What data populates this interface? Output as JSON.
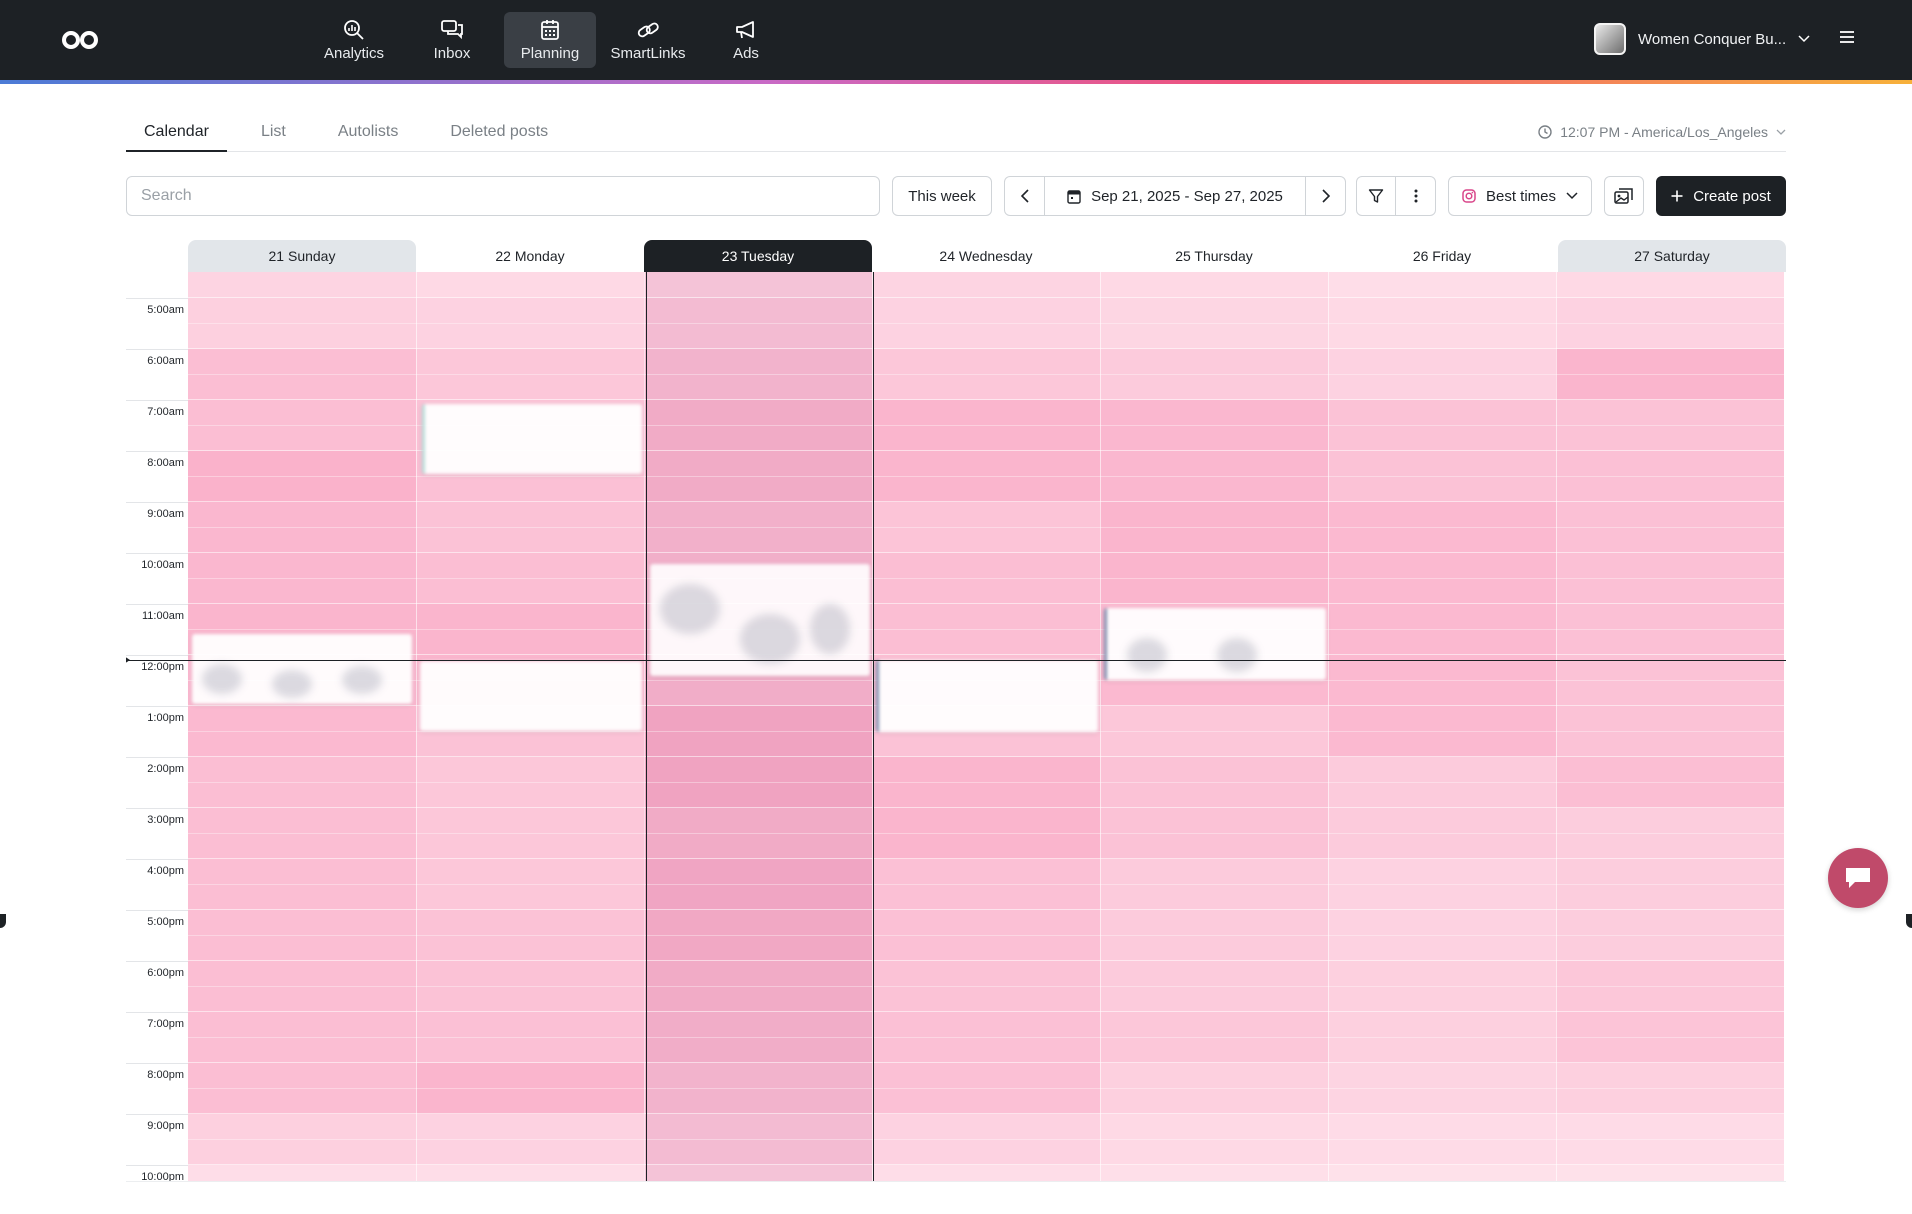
{
  "nav": {
    "items": [
      {
        "label": "Analytics",
        "icon": "analytics-icon",
        "active": false
      },
      {
        "label": "Inbox",
        "icon": "inbox-icon",
        "active": false
      },
      {
        "label": "Planning",
        "icon": "calendar-icon",
        "active": true
      },
      {
        "label": "SmartLinks",
        "icon": "link-icon",
        "active": false
      },
      {
        "label": "Ads",
        "icon": "megaphone-icon",
        "active": false
      }
    ]
  },
  "account": {
    "name": "Women Conquer Bu..."
  },
  "tabs": [
    {
      "label": "Calendar",
      "active": true
    },
    {
      "label": "List",
      "active": false
    },
    {
      "label": "Autolists",
      "active": false
    },
    {
      "label": "Deleted posts",
      "active": false
    }
  ],
  "timezone": {
    "label": "12:07 PM - America/Los_Angeles"
  },
  "toolbar": {
    "search_placeholder": "Search",
    "this_week_label": "This week",
    "date_range": "Sep 21, 2025 - Sep 27, 2025",
    "best_times_label": "Best times",
    "create_post_label": "Create post"
  },
  "days": [
    {
      "label": "21 Sunday",
      "type": "weekend"
    },
    {
      "label": "22 Monday",
      "type": "weekday"
    },
    {
      "label": "23 Tuesday",
      "type": "today"
    },
    {
      "label": "24 Wednesday",
      "type": "weekday"
    },
    {
      "label": "25 Thursday",
      "type": "weekday"
    },
    {
      "label": "26 Friday",
      "type": "weekday"
    },
    {
      "label": "27 Saturday",
      "type": "weekend"
    }
  ],
  "hours": [
    "5:00am",
    "6:00am",
    "7:00am",
    "8:00am",
    "9:00am",
    "10:00am",
    "11:00am",
    "12:00pm",
    "1:00pm",
    "2:00pm",
    "3:00pm",
    "4:00pm",
    "5:00pm",
    "6:00pm",
    "7:00pm",
    "8:00pm",
    "9:00pm",
    "10:00pm"
  ],
  "best_times_heat": [
    [
      0.2,
      0.25,
      0.45,
      0.45,
      0.58,
      0.52,
      0.52,
      0.55,
      0.52,
      0.5,
      0.45,
      0.45,
      0.45,
      0.45,
      0.45,
      0.45,
      0.45,
      0.25,
      0.1
    ],
    [
      0.15,
      0.22,
      0.35,
      0.4,
      0.42,
      0.4,
      0.45,
      0.55,
      0.55,
      0.4,
      0.35,
      0.35,
      0.35,
      0.4,
      0.4,
      0.42,
      0.55,
      0.22,
      0.1
    ],
    [
      0.15,
      0.25,
      0.35,
      0.45,
      0.45,
      0.38,
      0.4,
      0.4,
      0.42,
      0.55,
      0.55,
      0.45,
      0.52,
      0.48,
      0.45,
      0.42,
      0.35,
      0.25,
      0.15
    ],
    [
      0.2,
      0.22,
      0.35,
      0.55,
      0.55,
      0.38,
      0.45,
      0.45,
      0.45,
      0.4,
      0.55,
      0.55,
      0.42,
      0.42,
      0.4,
      0.42,
      0.42,
      0.22,
      0.1
    ],
    [
      0.15,
      0.18,
      0.3,
      0.52,
      0.52,
      0.55,
      0.55,
      0.5,
      0.5,
      0.35,
      0.4,
      0.4,
      0.3,
      0.3,
      0.3,
      0.35,
      0.25,
      0.15,
      0.08
    ],
    [
      0.1,
      0.15,
      0.22,
      0.4,
      0.4,
      0.5,
      0.5,
      0.5,
      0.5,
      0.5,
      0.3,
      0.3,
      0.22,
      0.22,
      0.25,
      0.25,
      0.2,
      0.12,
      0.06
    ],
    [
      0.15,
      0.22,
      0.55,
      0.4,
      0.42,
      0.42,
      0.42,
      0.42,
      0.4,
      0.4,
      0.45,
      0.28,
      0.28,
      0.28,
      0.35,
      0.38,
      0.25,
      0.12,
      0.06
    ]
  ],
  "colors": {
    "topbar": "#1d2125",
    "heat_base": "#f7a6c4",
    "accent_dark": "#1d2125",
    "chat_bubble": "#c04a6a"
  }
}
